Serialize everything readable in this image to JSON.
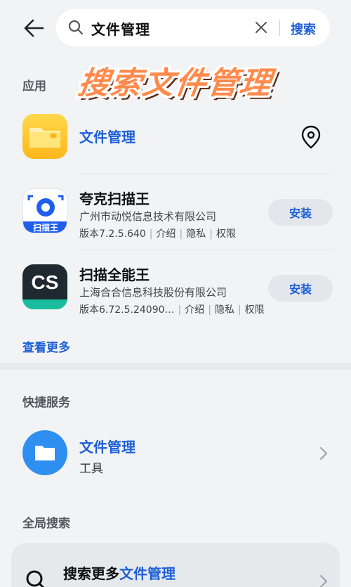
{
  "search": {
    "query": "文件管理",
    "submit_label": "搜索"
  },
  "overlay": {
    "title": "搜索文件管理"
  },
  "apps_section": {
    "label": "应用",
    "top_result": {
      "name": "文件管理",
      "icon": "folder-app-icon"
    },
    "items": [
      {
        "name": "夸克扫描王",
        "developer": "广州市动悦信息技术有限公司",
        "version": "版本7.2.5.640",
        "intro": "介绍",
        "privacy": "隐私",
        "permissions": "权限",
        "button": "安装",
        "icon_label": "扫描王"
      },
      {
        "name": "扫描全能王",
        "developer": "上海合合信息科技股份有限公司",
        "version": "版本6.72.5.24090…",
        "intro": "介绍",
        "privacy": "隐私",
        "permissions": "权限",
        "button": "安装",
        "icon_label": "CS"
      }
    ],
    "more_label": "查看更多"
  },
  "quick_section": {
    "label": "快捷服务",
    "item": {
      "name": "文件管理",
      "category": "工具"
    }
  },
  "global_section": {
    "label": "全局搜索",
    "prefix": "搜索更多",
    "keyword": "文件管理"
  },
  "colors": {
    "accent": "#1d5fd6",
    "background": "#f1f3f5",
    "overlay_title": "#ff8a4c"
  }
}
